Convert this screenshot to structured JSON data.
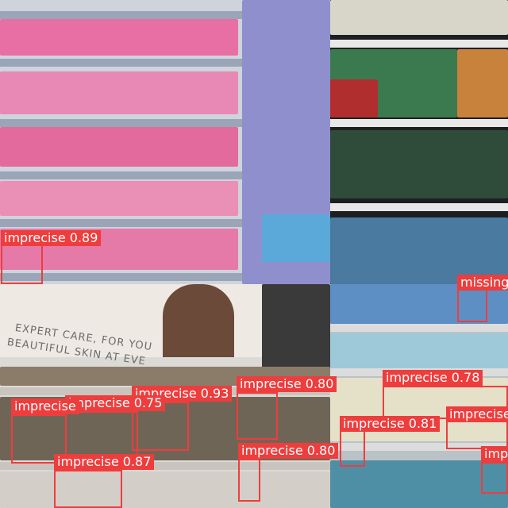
{
  "image": {
    "kind": "mosaic of four retail shelf photos with object detection overlays",
    "accent_color": "#ee3d3d"
  },
  "ad": {
    "line1": "EXPERT CARE, FOR YOU",
    "line2": "BEAUTIFUL SKIN AT EVE"
  },
  "detections": [
    {
      "label": "imprecise",
      "score": "0.89"
    },
    {
      "label": "missing",
      "score": ""
    },
    {
      "label": "imprecise",
      "score": "0.80"
    },
    {
      "label": "imprecise",
      "score": "0.93"
    },
    {
      "label": "imprecise",
      "score": "0.75"
    },
    {
      "label": "imprecise",
      "score": ""
    },
    {
      "label": "imprecise",
      "score": "0.78"
    },
    {
      "label": "imprecise",
      "score": ""
    },
    {
      "label": "imprecise",
      "score": "0.81"
    },
    {
      "label": "imprecise",
      "score": "0.87"
    },
    {
      "label": "imprecise",
      "score": "0.80"
    },
    {
      "label": "imp",
      "score": ""
    }
  ]
}
